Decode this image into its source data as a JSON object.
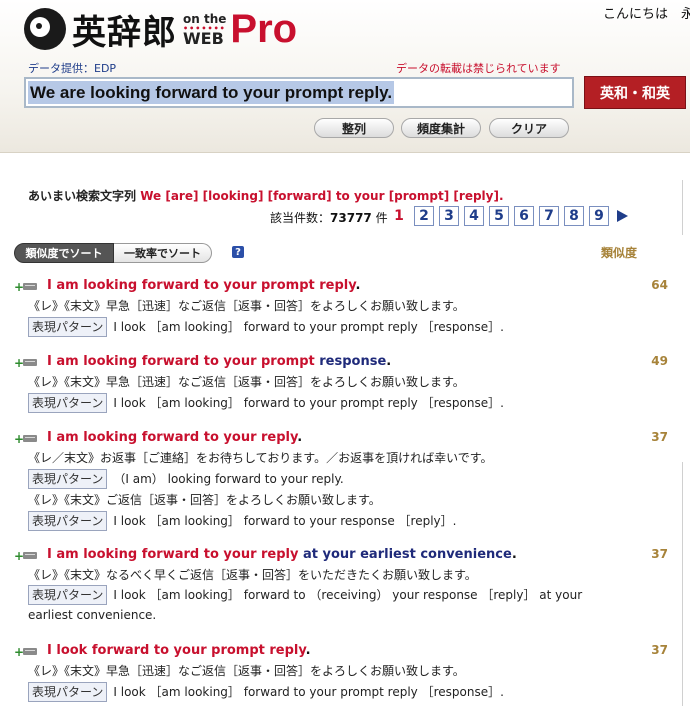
{
  "header": {
    "logo_kanji": "英辞郎",
    "logo_on_the": "on the",
    "logo_dots": "•••••••",
    "logo_web": "WEB",
    "logo_pro": "Pro",
    "greeting": "こんにちは　永",
    "data_source": "データ提供：EDP",
    "copyright_note": "データの転載は禁じられています",
    "search_value": "We are looking forward to your prompt reply.",
    "dict_button": "英和・和英",
    "buttons": {
      "arrange": "整列",
      "frequency": "頻度集計",
      "clear": "クリア"
    }
  },
  "results": {
    "fuzzy_label": "あいまい検索文字列",
    "fuzzy_query": "We [are] [looking] [forward] to your [prompt] [reply].",
    "hit_label": "該当件数：",
    "hit_count": "73777",
    "hit_unit": "件",
    "current_page": "1",
    "pages": [
      "2",
      "3",
      "4",
      "5",
      "6",
      "7",
      "8",
      "9"
    ],
    "sort_similarity": "類似度でソート",
    "sort_match": "一致率でソート",
    "help": "?",
    "similarity_header": "類似度",
    "pattern_label": "表現パターン",
    "entries": [
      {
        "en_red": "I am looking forward to your prompt reply",
        "en_blue": "",
        "en_end": ".",
        "score": "64",
        "lines": [
          "《レ》《末文》早急［迅速］なご返信［返事・回答］をよろしくお願い致します。"
        ],
        "patterns": [
          "I look ［am looking］ forward to your prompt reply ［response］."
        ]
      },
      {
        "en_red": "I am looking forward to your prompt",
        "en_blue": "response",
        "en_end": ".",
        "score": "49",
        "lines": [
          "《レ》《末文》早急［迅速］なご返信［返事・回答］をよろしくお願い致します。"
        ],
        "patterns": [
          "I look ［am looking］ forward to your prompt reply ［response］."
        ]
      },
      {
        "en_red": "I am looking forward to your reply",
        "en_blue": "",
        "en_end": ".",
        "score": "37",
        "lines": [
          "《レ／末文》お返事［ご連絡］をお待ちしております。／お返事を頂ければ幸いです。",
          "《レ》《末文》ご返信［返事・回答］をよろしくお願い致します。"
        ],
        "patterns": [
          "（I am） looking forward to your reply.",
          "I look ［am looking］ forward to your response ［reply］."
        ]
      },
      {
        "en_red": "I am looking forward to your reply",
        "en_blue": "at your earliest convenience",
        "en_end": ".",
        "score": "37",
        "lines": [
          "《レ》《末文》なるべく早くご返信［返事・回答］をいただきたくお願い致します。"
        ],
        "patterns": [
          "I look ［am looking］ forward to （receiving） your response ［reply］ at your earliest convenience."
        ]
      },
      {
        "en_red": "I look forward to your prompt reply",
        "en_blue": "",
        "en_end": ".",
        "score": "37",
        "lines": [
          "《レ》《末文》早急［迅速］なご返信［返事・回答］をよろしくお願い致します。"
        ],
        "patterns": [
          "I look ［am looking］ forward to your prompt reply ［response］."
        ]
      }
    ]
  }
}
